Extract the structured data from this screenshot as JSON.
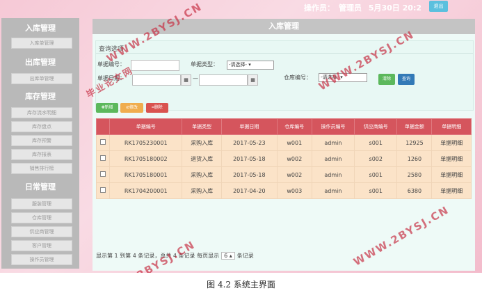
{
  "header": {
    "operator_label": "操作员：",
    "operator_name": "管理员",
    "datetime": "5月30日 20:2",
    "logout_label": "退出"
  },
  "sidebar": {
    "sections": [
      {
        "title": "入库管理",
        "items": [
          "入库单管理"
        ]
      },
      {
        "title": "出库管理",
        "items": [
          "出库单管理"
        ]
      },
      {
        "title": "库存管理",
        "items": [
          "库存流水明细",
          "库存盘点",
          "库存预警",
          "库存报表",
          "销售排行榜"
        ]
      },
      {
        "title": "日常管理",
        "items": [
          "服装管理",
          "仓库管理",
          "供应商管理",
          "客户管理",
          "操作员管理"
        ]
      }
    ]
  },
  "main": {
    "title": "入库管理"
  },
  "query": {
    "title": "查询选项",
    "bill_no_label": "单据编号：",
    "bill_type_label": "单据类型：",
    "bill_type_value": "-请选择-",
    "bill_date_label": "单据日期：",
    "date_sep": "—",
    "warehouse_label": "仓库编号：",
    "warehouse_value": "-请选择-",
    "clear_label": "清除",
    "search_label": "查询"
  },
  "actions": {
    "add": "新增",
    "edit": "修改",
    "delete": "删除"
  },
  "table": {
    "headers": [
      "单据编号",
      "单据类型",
      "单据日期",
      "仓库编号",
      "操作员编号",
      "供应商编号",
      "单据金额",
      "单据明细"
    ],
    "rows": [
      [
        "RK1705230001",
        "采购入库",
        "2017-05-23",
        "w001",
        "admin",
        "s001",
        "12925",
        "单据明细"
      ],
      [
        "RK1705180002",
        "退货入库",
        "2017-05-18",
        "w002",
        "admin",
        "s002",
        "1260",
        "单据明细"
      ],
      [
        "RK1705180001",
        "采购入库",
        "2017-05-18",
        "w002",
        "admin",
        "s001",
        "2580",
        "单据明细"
      ],
      [
        "RK1704200001",
        "采购入库",
        "2017-04-20",
        "w003",
        "admin",
        "s001",
        "6380",
        "单据明细"
      ]
    ]
  },
  "pager": {
    "prefix": "显示第 1 到第 4 条记录，总共 4 条记录 每页显示",
    "page_size": "6",
    "suffix": "条记录"
  },
  "watermark": "WWW.2BYSJ.CN",
  "watermark_cn": "毕业论文网",
  "caption": "图 4.2 系统主界面"
}
